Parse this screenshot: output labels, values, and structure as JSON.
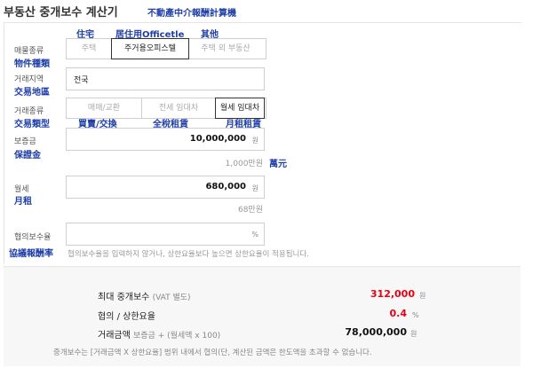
{
  "title": "부동산 중개보수 계산기",
  "title_cn": "不動產中介報酬計算機",
  "property": {
    "label": "매물종류",
    "label_cn": "物件種類",
    "options": [
      "주택",
      "주거용오피스텔",
      "주택 외 부동산"
    ],
    "annotations": [
      "住宅",
      "居住用Officetle",
      "其他"
    ],
    "selected": "주거용오피스텔"
  },
  "region": {
    "label": "거래지역",
    "label_cn": "交易地區",
    "value": "전국"
  },
  "trade": {
    "label": "거래종류",
    "label_cn": "交易類型",
    "options": [
      "매매/교환",
      "전세 임대차",
      "월세 임대차"
    ],
    "annotations": [
      "買賣/交換",
      "全稅租賃",
      "月租租賃"
    ],
    "selected": "월세 임대차"
  },
  "deposit": {
    "label": "보증금",
    "label_cn": "保證金",
    "value": "10,000,000",
    "unit": "원",
    "hint": "1,000만원",
    "hint_cn": "萬元"
  },
  "monthly": {
    "label": "월세",
    "label_cn": "月租",
    "value": "680,000",
    "unit": "원",
    "hint": "68만원"
  },
  "rate": {
    "label": "협의보수율",
    "label_cn": "協議報酬率",
    "value": "",
    "unit": "%",
    "hint": "협의보수율을 입력하지 않거나, 상한요율보다 높으면 상한요율이 적용됩니다."
  },
  "result": {
    "max_fee_label": "최대 중개보수",
    "max_fee_note": "(VAT 별도)",
    "max_fee_value": "312,000",
    "max_fee_unit": "원",
    "rate_label": "협의 / 상한요율",
    "rate_value": "0.4",
    "rate_unit": "%",
    "amount_label": "거래금액",
    "amount_formula": "보증금 + (월세액 x 100)",
    "amount_value": "78,000,000",
    "amount_unit": "원",
    "footnote": "중개보수는 [거래금액 X 상한요율] 범위 내에서 협의(단, 계산된 금액은 한도액을 초과할 수 없습니다.",
    "accent_color": "#e60012"
  }
}
